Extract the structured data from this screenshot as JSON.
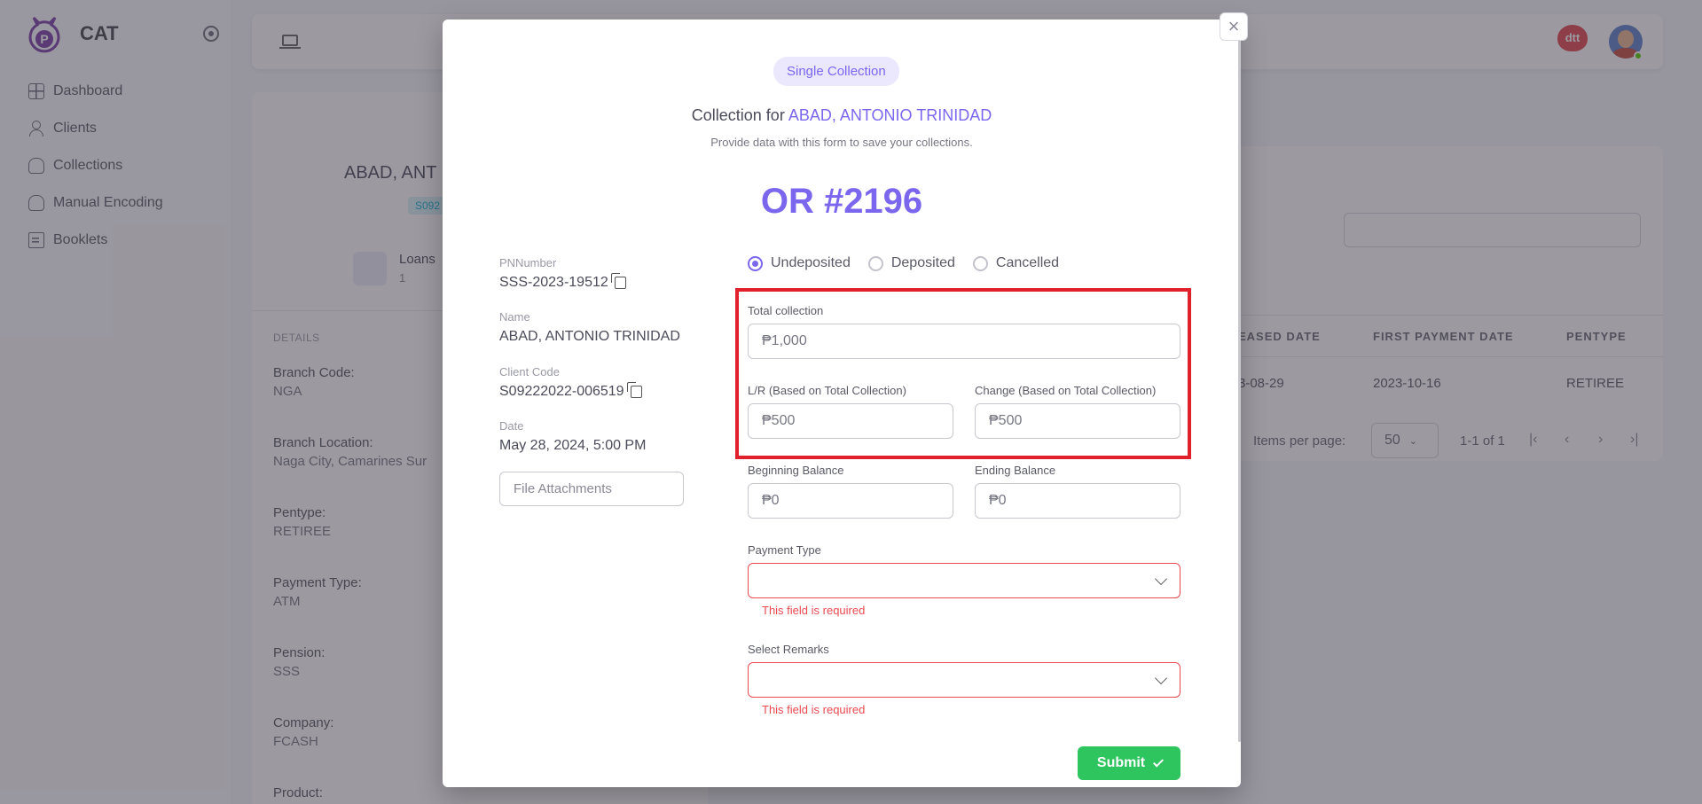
{
  "app": {
    "name": "CAT"
  },
  "sidebar": {
    "items": [
      {
        "label": "Dashboard"
      },
      {
        "label": "Clients"
      },
      {
        "label": "Collections"
      },
      {
        "label": "Manual Encoding"
      },
      {
        "label": "Booklets"
      }
    ]
  },
  "header": {
    "partner_logo_text": "dtt"
  },
  "client_card": {
    "name": "ABAD, ANT",
    "code_chip": "S092",
    "loans_label": "Loans",
    "loans_count": "1",
    "details_heading": "DETAILS",
    "details": [
      {
        "key": "Branch Code:",
        "value": "NGA"
      },
      {
        "key": "Branch Location:",
        "value": "Naga City, Camarines Sur"
      },
      {
        "key": "Pentype:",
        "value": "RETIREE"
      },
      {
        "key": "Payment Type:",
        "value": "ATM"
      },
      {
        "key": "Pension:",
        "value": "SSS"
      },
      {
        "key": "Company:",
        "value": "FCASH"
      },
      {
        "key": "Product:",
        "value": ""
      }
    ]
  },
  "loans_table": {
    "columns": [
      "EASED DATE",
      "FIRST PAYMENT DATE",
      "PENTYPE"
    ],
    "rows": [
      [
        "3-08-29",
        "2023-10-16",
        "RETIREE"
      ]
    ],
    "items_per_page_label": "Items per page:",
    "items_per_page": "50",
    "range": "1-1 of 1"
  },
  "modal": {
    "chip": "Single Collection",
    "title_prefix": "Collection for",
    "client_name": "ABAD, ANTONIO TRINIDAD",
    "subtitle": "Provide data with this form to save your collections.",
    "or_number": "OR #2196",
    "info": {
      "pn_label": "PNNumber",
      "pn_value": "SSS-2023-19512",
      "name_label": "Name",
      "name_value": "ABAD, ANTONIO TRINIDAD",
      "code_label": "Client Code",
      "code_value": "S09222022-006519",
      "date_label": "Date",
      "date_value": "May 28, 2024, 5:00 PM"
    },
    "file_attachments": "File Attachments",
    "status_options": [
      {
        "label": "Undeposited",
        "selected": true
      },
      {
        "label": "Deposited",
        "selected": false
      },
      {
        "label": "Cancelled",
        "selected": false
      }
    ],
    "fields": {
      "total_collection": {
        "label": "Total collection",
        "value": "₱1,000"
      },
      "lr": {
        "label": "L/R (Based on Total Collection)",
        "value": "₱500"
      },
      "change": {
        "label": "Change (Based on Total Collection)",
        "value": "₱500"
      },
      "beginning_balance": {
        "label": "Beginning Balance",
        "value": "₱0"
      },
      "ending_balance": {
        "label": "Ending Balance",
        "value": "₱0"
      },
      "payment_type": {
        "label": "Payment Type",
        "value": "",
        "error": "This field is required"
      },
      "remarks": {
        "label": "Select Remarks",
        "value": "",
        "error": "This field is required"
      }
    },
    "submit_label": "Submit",
    "close_glyph": "×"
  },
  "colors": {
    "accent": "#7b67ee",
    "success": "#2ec45e",
    "error": "#e84a50",
    "highlight": "#e0202a"
  }
}
